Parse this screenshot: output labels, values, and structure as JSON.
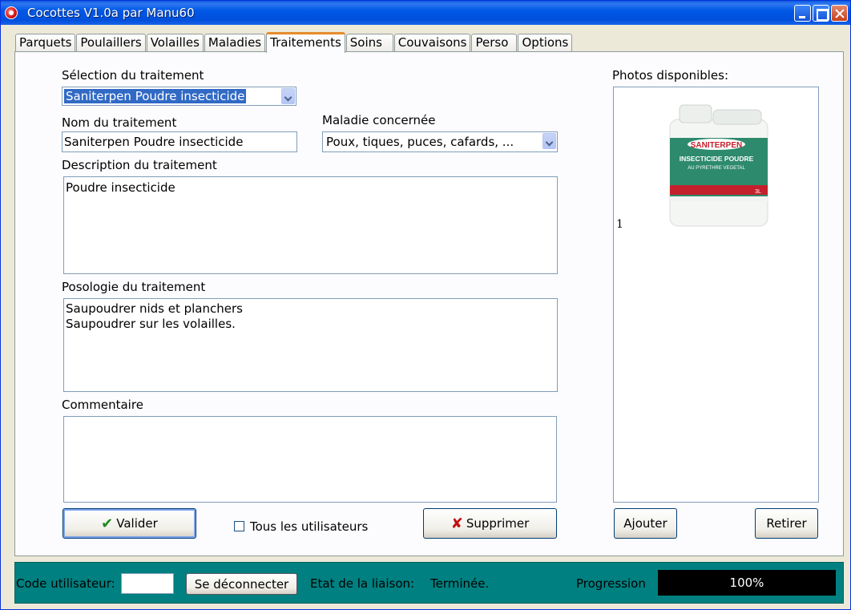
{
  "window": {
    "title": "Cocottes V1.0a par Manu60"
  },
  "tabs": [
    "Parquets",
    "Poulaillers",
    "Volailles",
    "Maladies",
    "Traitements",
    "Soins",
    "Couvaisons",
    "Perso",
    "Options"
  ],
  "active_tab": "Traitements",
  "form": {
    "selection_label": "Sélection du traitement",
    "selection_value": "Saniterpen Poudre insecticide",
    "name_label": "Nom du traitement",
    "name_value": "Saniterpen Poudre insecticide",
    "disease_label": "Maladie concernée",
    "disease_value": "Poux, tiques, puces, cafards, ...",
    "description_label": "Description du traitement",
    "description_value": "Poudre insecticide",
    "posology_label": "Posologie du traitement",
    "posology_value": "Saupoudrer nids et planchers\nSaupoudrer sur les volailles.",
    "comment_label": "Commentaire",
    "comment_value": ""
  },
  "buttons": {
    "validate": "Valider",
    "all_users": "Tous les utilisateurs",
    "delete": "Supprimer",
    "add": "Ajouter",
    "remove": "Retirer"
  },
  "photos": {
    "label": "Photos disponibles:",
    "index": "1",
    "product_brand": "SANITERPEN",
    "product_title": "INSECTICIDE POUDRE",
    "product_subtitle": "AU PYRETHRE VEGETAL",
    "product_volume": "3L"
  },
  "status": {
    "user_code_label": "Code utilisateur:",
    "user_code_value": "",
    "disconnect": "Se déconnecter",
    "link_label": "Etat de la liaison:",
    "link_value": "Terminée.",
    "progress_label": "Progression",
    "progress_text": "100%",
    "progress_fraction": 1.0
  },
  "colors": {
    "accent": "#316ac5",
    "statusbar": "#008080",
    "tab_highlight": "#e68b2c"
  }
}
